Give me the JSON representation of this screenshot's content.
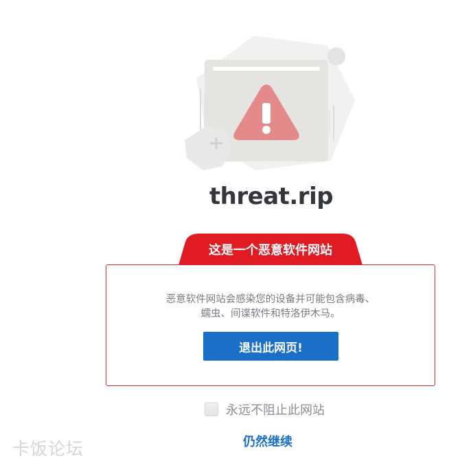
{
  "illustration": {
    "icons": [
      "warning-triangle-icon",
      "browser-window-icon",
      "plus-icon"
    ],
    "colors": {
      "triangle": "#e58a8a",
      "window": "#e6e4e0",
      "hexagon": "#f0f0f0"
    }
  },
  "site": {
    "domain": "threat.rip"
  },
  "warning": {
    "tab_label": "这是一个恶意软件网站",
    "description_line1": "恶意软件网站会感染您的设备并可能包含病毒、",
    "description_line2": "蠕虫、间谍软件和特洛伊木马。",
    "exit_button_label": "退出此网页!"
  },
  "options": {
    "never_block_label": "永远不阻止此网站",
    "never_block_checked": false,
    "continue_label": "仍然继续"
  },
  "watermark": {
    "text": "卡饭论坛"
  },
  "colors": {
    "accent_red": "#e01b24",
    "accent_blue": "#1a6fc9",
    "border_red": "#cf2d3c"
  }
}
